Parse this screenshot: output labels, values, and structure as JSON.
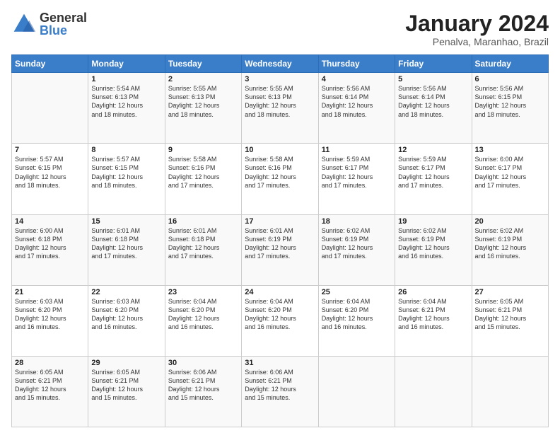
{
  "logo": {
    "general": "General",
    "blue": "Blue"
  },
  "title": "January 2024",
  "subtitle": "Penalva, Maranhao, Brazil",
  "weekdays": [
    "Sunday",
    "Monday",
    "Tuesday",
    "Wednesday",
    "Thursday",
    "Friday",
    "Saturday"
  ],
  "weeks": [
    [
      {
        "day": "",
        "info": ""
      },
      {
        "day": "1",
        "info": "Sunrise: 5:54 AM\nSunset: 6:13 PM\nDaylight: 12 hours\nand 18 minutes."
      },
      {
        "day": "2",
        "info": "Sunrise: 5:55 AM\nSunset: 6:13 PM\nDaylight: 12 hours\nand 18 minutes."
      },
      {
        "day": "3",
        "info": "Sunrise: 5:55 AM\nSunset: 6:13 PM\nDaylight: 12 hours\nand 18 minutes."
      },
      {
        "day": "4",
        "info": "Sunrise: 5:56 AM\nSunset: 6:14 PM\nDaylight: 12 hours\nand 18 minutes."
      },
      {
        "day": "5",
        "info": "Sunrise: 5:56 AM\nSunset: 6:14 PM\nDaylight: 12 hours\nand 18 minutes."
      },
      {
        "day": "6",
        "info": "Sunrise: 5:56 AM\nSunset: 6:15 PM\nDaylight: 12 hours\nand 18 minutes."
      }
    ],
    [
      {
        "day": "7",
        "info": "Sunrise: 5:57 AM\nSunset: 6:15 PM\nDaylight: 12 hours\nand 18 minutes."
      },
      {
        "day": "8",
        "info": "Sunrise: 5:57 AM\nSunset: 6:15 PM\nDaylight: 12 hours\nand 18 minutes."
      },
      {
        "day": "9",
        "info": "Sunrise: 5:58 AM\nSunset: 6:16 PM\nDaylight: 12 hours\nand 17 minutes."
      },
      {
        "day": "10",
        "info": "Sunrise: 5:58 AM\nSunset: 6:16 PM\nDaylight: 12 hours\nand 17 minutes."
      },
      {
        "day": "11",
        "info": "Sunrise: 5:59 AM\nSunset: 6:17 PM\nDaylight: 12 hours\nand 17 minutes."
      },
      {
        "day": "12",
        "info": "Sunrise: 5:59 AM\nSunset: 6:17 PM\nDaylight: 12 hours\nand 17 minutes."
      },
      {
        "day": "13",
        "info": "Sunrise: 6:00 AM\nSunset: 6:17 PM\nDaylight: 12 hours\nand 17 minutes."
      }
    ],
    [
      {
        "day": "14",
        "info": "Sunrise: 6:00 AM\nSunset: 6:18 PM\nDaylight: 12 hours\nand 17 minutes."
      },
      {
        "day": "15",
        "info": "Sunrise: 6:01 AM\nSunset: 6:18 PM\nDaylight: 12 hours\nand 17 minutes."
      },
      {
        "day": "16",
        "info": "Sunrise: 6:01 AM\nSunset: 6:18 PM\nDaylight: 12 hours\nand 17 minutes."
      },
      {
        "day": "17",
        "info": "Sunrise: 6:01 AM\nSunset: 6:19 PM\nDaylight: 12 hours\nand 17 minutes."
      },
      {
        "day": "18",
        "info": "Sunrise: 6:02 AM\nSunset: 6:19 PM\nDaylight: 12 hours\nand 17 minutes."
      },
      {
        "day": "19",
        "info": "Sunrise: 6:02 AM\nSunset: 6:19 PM\nDaylight: 12 hours\nand 16 minutes."
      },
      {
        "day": "20",
        "info": "Sunrise: 6:02 AM\nSunset: 6:19 PM\nDaylight: 12 hours\nand 16 minutes."
      }
    ],
    [
      {
        "day": "21",
        "info": "Sunrise: 6:03 AM\nSunset: 6:20 PM\nDaylight: 12 hours\nand 16 minutes."
      },
      {
        "day": "22",
        "info": "Sunrise: 6:03 AM\nSunset: 6:20 PM\nDaylight: 12 hours\nand 16 minutes."
      },
      {
        "day": "23",
        "info": "Sunrise: 6:04 AM\nSunset: 6:20 PM\nDaylight: 12 hours\nand 16 minutes."
      },
      {
        "day": "24",
        "info": "Sunrise: 6:04 AM\nSunset: 6:20 PM\nDaylight: 12 hours\nand 16 minutes."
      },
      {
        "day": "25",
        "info": "Sunrise: 6:04 AM\nSunset: 6:20 PM\nDaylight: 12 hours\nand 16 minutes."
      },
      {
        "day": "26",
        "info": "Sunrise: 6:04 AM\nSunset: 6:21 PM\nDaylight: 12 hours\nand 16 minutes."
      },
      {
        "day": "27",
        "info": "Sunrise: 6:05 AM\nSunset: 6:21 PM\nDaylight: 12 hours\nand 15 minutes."
      }
    ],
    [
      {
        "day": "28",
        "info": "Sunrise: 6:05 AM\nSunset: 6:21 PM\nDaylight: 12 hours\nand 15 minutes."
      },
      {
        "day": "29",
        "info": "Sunrise: 6:05 AM\nSunset: 6:21 PM\nDaylight: 12 hours\nand 15 minutes."
      },
      {
        "day": "30",
        "info": "Sunrise: 6:06 AM\nSunset: 6:21 PM\nDaylight: 12 hours\nand 15 minutes."
      },
      {
        "day": "31",
        "info": "Sunrise: 6:06 AM\nSunset: 6:21 PM\nDaylight: 12 hours\nand 15 minutes."
      },
      {
        "day": "",
        "info": ""
      },
      {
        "day": "",
        "info": ""
      },
      {
        "day": "",
        "info": ""
      }
    ]
  ]
}
